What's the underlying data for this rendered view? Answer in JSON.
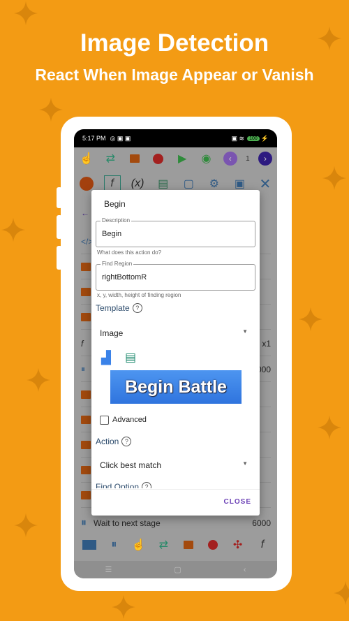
{
  "promo": {
    "title": "Image Detection",
    "subtitle": "React When Image Appear or Vanish"
  },
  "status_bar": {
    "time": "5:17 PM",
    "battery": "100"
  },
  "toolbar": {
    "page_number": "1"
  },
  "background_list": {
    "row_f_value": "x1",
    "row_pause_value": "6000",
    "last_row_label": "Wait to next stage",
    "last_row_value": "6000"
  },
  "dialog": {
    "title": "Begin",
    "description": {
      "label": "Description",
      "value": "Begin",
      "helper": "What does this action do?"
    },
    "find_region": {
      "label": "Find Region",
      "value": "rightBottomR",
      "helper": "x, y, width, height of finding region"
    },
    "template": {
      "label": "Template",
      "selected": "Image",
      "image_text": "Begin Battle"
    },
    "advanced_label": "Advanced",
    "advanced_checked": false,
    "action": {
      "label": "Action",
      "selected": "Click best match"
    },
    "find_option_label": "Find Option",
    "close_label": "CLOSE"
  },
  "colors": {
    "background": "#F39B14",
    "accent": "#6a3fb5",
    "template_blue": "#3a82e8"
  }
}
